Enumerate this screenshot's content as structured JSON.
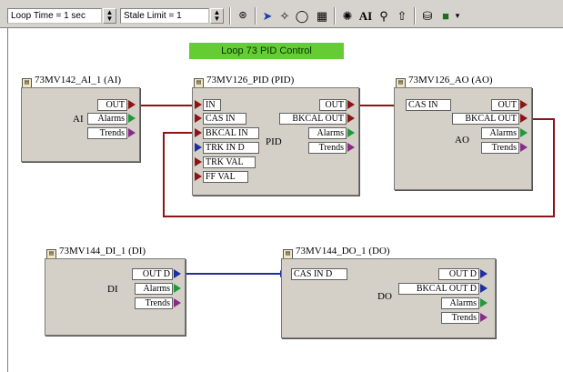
{
  "toolbar": {
    "loop_time": "Loop Time = 1 sec",
    "stale_limit": "Stale Limit = 1",
    "icons": [
      "ok-icon",
      "pointer-icon",
      "connect-icon",
      "rotate-icon",
      "grid-icon",
      "settings-icon",
      "text-icon",
      "zoom-icon",
      "hand-icon",
      "paint-icon",
      "fill-color-icon"
    ]
  },
  "banner": "Loop 73 PID Control",
  "blocks": {
    "ai": {
      "title": "73MV142_AI_1 (AI)",
      "type": "AI",
      "outputs": [
        "OUT",
        "Alarms",
        "Trends"
      ]
    },
    "pid": {
      "title": "73MV126_PID (PID)",
      "type": "PID",
      "inputs": [
        "IN",
        "CAS IN",
        "BKCAL IN",
        "TRK IN D",
        "TRK VAL",
        "FF VAL"
      ],
      "outputs": [
        "OUT",
        "BKCAL OUT",
        "Alarms",
        "Trends"
      ]
    },
    "ao": {
      "title": "73MV126_AO (AO)",
      "type": "AO",
      "inputs": [
        "CAS IN"
      ],
      "outputs": [
        "OUT",
        "BKCAL OUT",
        "Alarms",
        "Trends"
      ]
    },
    "di": {
      "title": "73MV144_DI_1 (DI)",
      "type": "DI",
      "outputs": [
        "OUT D",
        "Alarms",
        "Trends"
      ]
    },
    "do": {
      "title": "73MV144_DO_1 (DO)",
      "type": "DO",
      "inputs": [
        "CAS IN D"
      ],
      "outputs": [
        "OUT D",
        "BKCAL OUT D",
        "Alarms",
        "Trends"
      ]
    }
  },
  "colors": {
    "analog_wire": "#8b1515",
    "discrete_wire": "#1e2fa0",
    "banner_bg": "#66cc33"
  }
}
